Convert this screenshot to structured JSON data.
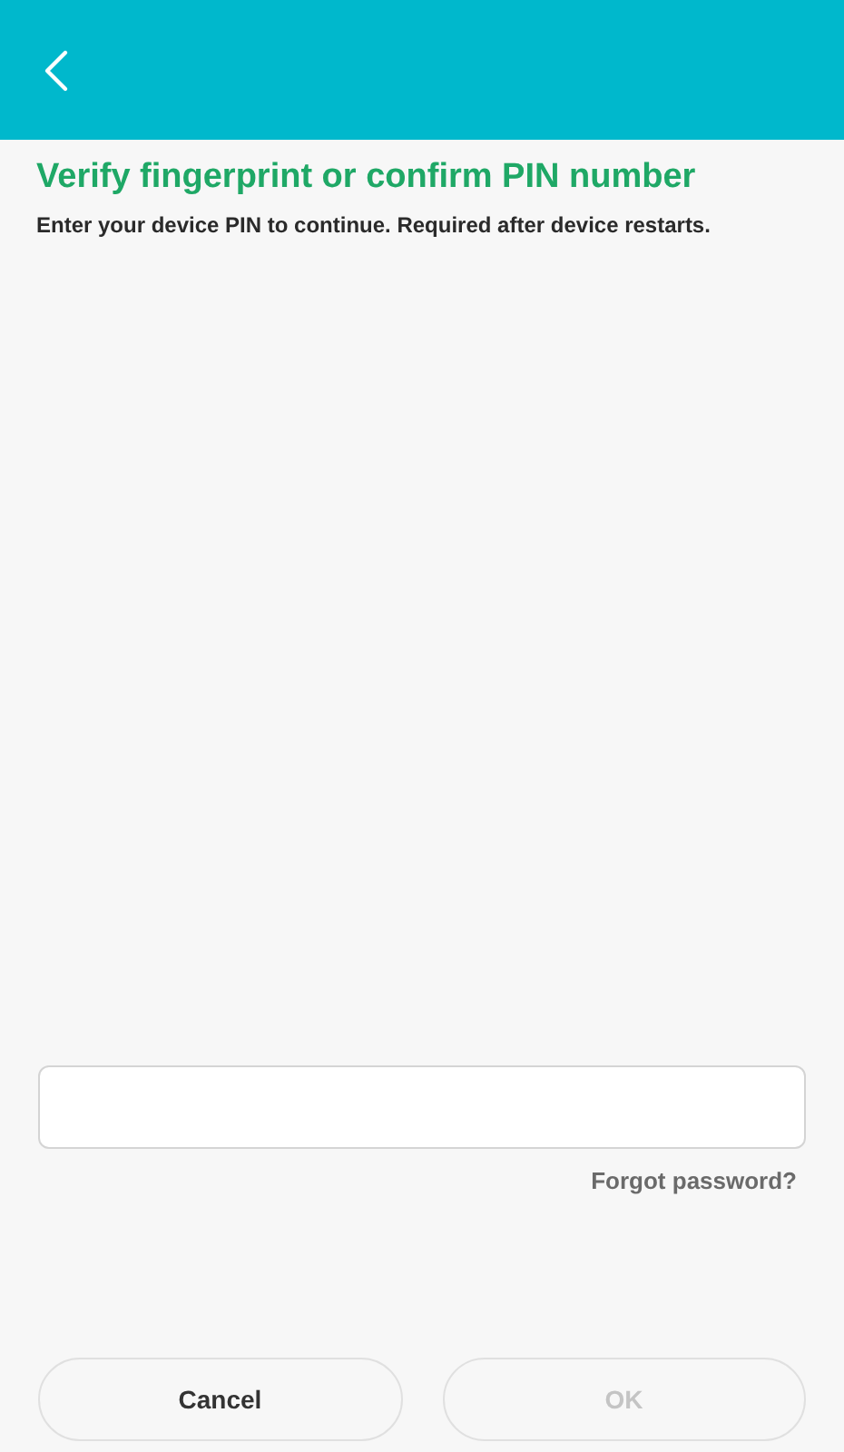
{
  "title": "Verify fingerprint or confirm PIN number",
  "subtitle": "Enter your device PIN to continue. Required after device restarts.",
  "forgot_link": "Forgot password?",
  "buttons": [
    {
      "label": "Cancel",
      "disabled": false
    },
    {
      "label": "OK",
      "disabled": true
    }
  ]
}
